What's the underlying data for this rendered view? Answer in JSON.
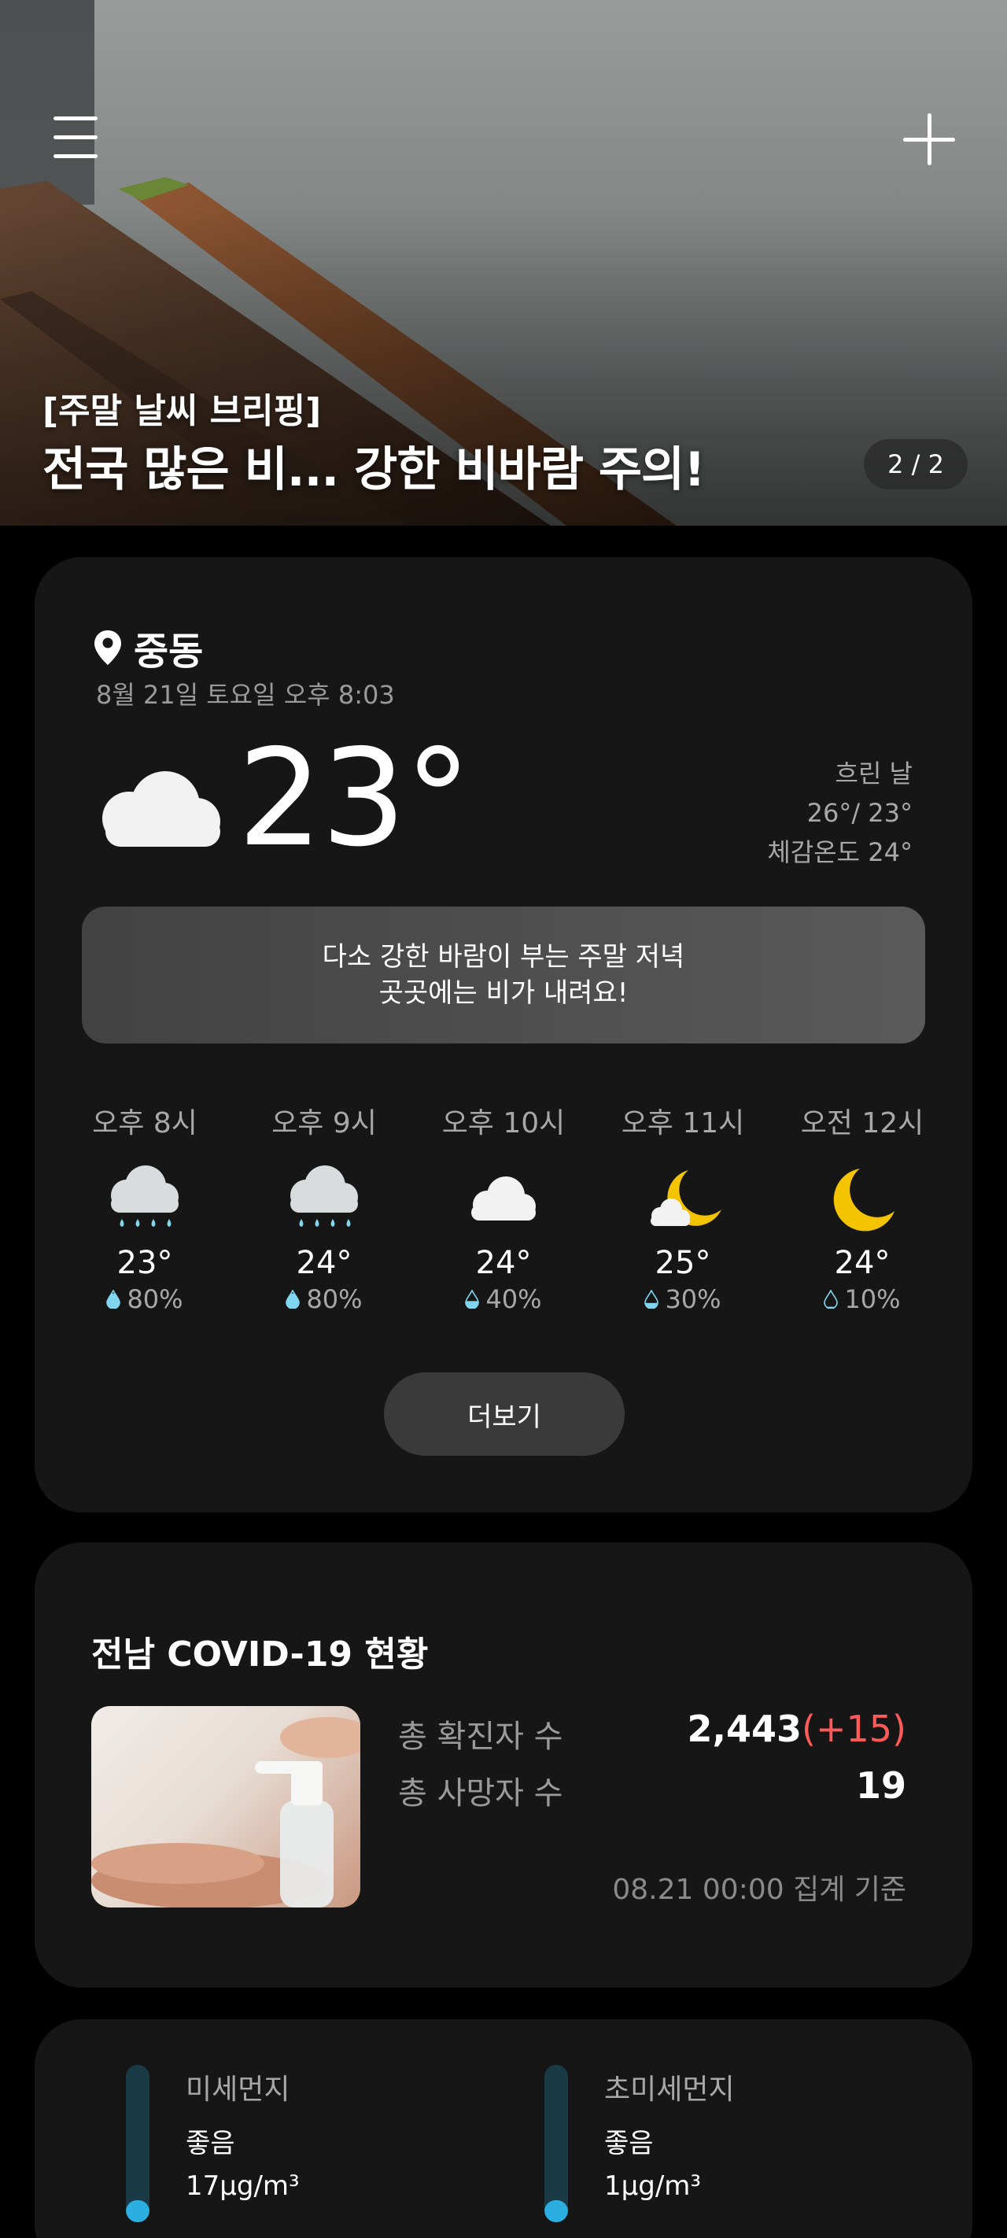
{
  "hero": {
    "subtitle": "[주말 날씨 브리핑]",
    "title": "전국 많은 비... 강한 비바람 주의!",
    "pager": "2 / 2"
  },
  "weather": {
    "location": "중동",
    "datetime": "8월 21일 토요일 오후 8:03",
    "temperature": "23°",
    "condition": "흐린 날",
    "high_low": "26°/ 23°",
    "feels_like": "체감온도 24°",
    "message_line1": "다소 강한 바람이 부는 주말 저녁",
    "message_line2": "곳곳에는 비가 내려요!",
    "hourly": [
      {
        "time": "오후 8시",
        "icon": "rain-cloud-icon",
        "temp": "23°",
        "rain": "80%",
        "rain_level": 0.8
      },
      {
        "time": "오후 9시",
        "icon": "rain-cloud-icon",
        "temp": "24°",
        "rain": "80%",
        "rain_level": 0.8
      },
      {
        "time": "오후 10시",
        "icon": "cloud-icon",
        "temp": "24°",
        "rain": "40%",
        "rain_level": 0.4
      },
      {
        "time": "오후 11시",
        "icon": "moon-cloud-icon",
        "temp": "25°",
        "rain": "30%",
        "rain_level": 0.3
      },
      {
        "time": "오전 12시",
        "icon": "moon-icon",
        "temp": "24°",
        "rain": "10%",
        "rain_level": 0.1
      }
    ],
    "more_label": "더보기"
  },
  "covid": {
    "title": "전남 COVID-19 현황",
    "confirmed_label": "총 확진자 수",
    "confirmed_value": "2,443",
    "confirmed_delta": "(+15)",
    "deaths_label": "총 사망자 수",
    "deaths_value": "19",
    "note": "08.21 00:00 집계 기준"
  },
  "dust": [
    {
      "label": "미세먼지",
      "grade": "좋음",
      "value": "17μg/m³",
      "level": 0.14
    },
    {
      "label": "초미세먼지",
      "grade": "좋음",
      "value": "1μg/m³",
      "level": 0.14
    }
  ],
  "colors": {
    "background": "#000000",
    "card": "#161616",
    "delta_red": "#ff5a5a",
    "moon_yellow": "#f5c400",
    "rain_blue": "#7fd6ee",
    "dust_blue": "#2baee0"
  }
}
